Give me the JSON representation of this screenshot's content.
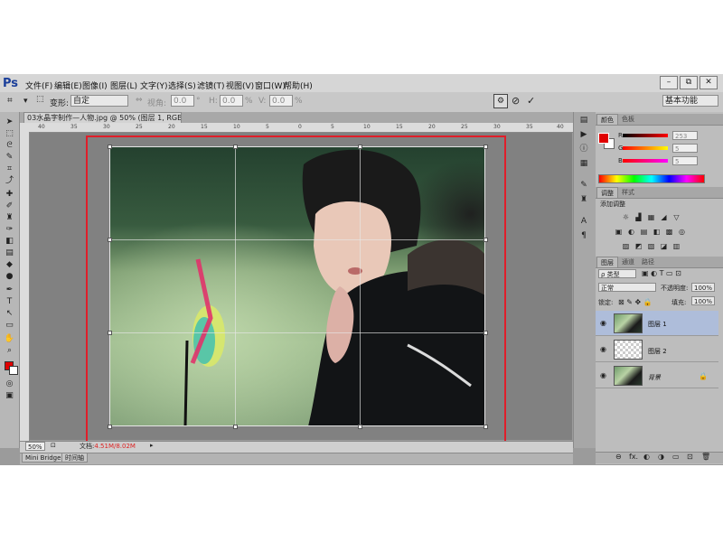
{
  "app": {
    "logo": "Ps"
  },
  "menu": [
    "文件(F)",
    "编辑(E)",
    "图像(I)",
    "图层(L)",
    "文字(Y)",
    "选择(S)",
    "滤镜(T)",
    "视图(V)",
    "窗口(W)",
    "帮助(H)"
  ],
  "window_controls": [
    "–",
    "⧉",
    "✕"
  ],
  "options": {
    "transform_label": "变形:",
    "preset_value": "自定",
    "h_label": "视角:",
    "h_value": "0.0",
    "hunit": "°",
    "v_label": "H:",
    "v_value": "0.0",
    "vunit": "%",
    "vh_label": "V:",
    "vh_value": "0.0",
    "workspace": "基本功能"
  },
  "document": {
    "tab_title": "03水晶字制作—人物.jpg @ 50% (图层 1, RGB/8#) *",
    "zoom": "50%",
    "doc_label": "文档:",
    "doc_size": "4.51M/8.02M"
  },
  "ruler_h_ticks": [
    "40",
    "35",
    "30",
    "25",
    "20",
    "15",
    "10",
    "5",
    "0",
    "5",
    "10",
    "15",
    "20",
    "25",
    "30",
    "35",
    "40"
  ],
  "bottom_tabs": [
    "Mini Bridge",
    "时间轴"
  ],
  "color_panel": {
    "tabs": [
      "颜色",
      "色板"
    ],
    "r_label": "R",
    "r_value": "253",
    "g_label": "G",
    "g_value": "5",
    "b_label": "B",
    "b_value": "5"
  },
  "adjust_panel": {
    "tabs": [
      "调整",
      "样式"
    ],
    "heading": "添加调整",
    "icons_row1": [
      "☼",
      "▟",
      "▦",
      "◢",
      "▽"
    ],
    "icons_row2": [
      "▣",
      "◐",
      "▤",
      "◧",
      "▩",
      "◎"
    ],
    "icons_row3": [
      "▨",
      "◩",
      "▧",
      "◪",
      "▥"
    ]
  },
  "layers_panel": {
    "tabs": [
      "图层",
      "通道",
      "路径"
    ],
    "filter_label": "ρ 类型",
    "blend_mode": "正常",
    "opacity_label": "不透明度:",
    "opacity_value": "100%",
    "lock_label": "锁定:",
    "fill_label": "填充:",
    "fill_value": "100%",
    "layers": [
      {
        "name": "图层 1"
      },
      {
        "name": "图层 2"
      },
      {
        "name": "背景"
      }
    ],
    "footer_icons": [
      "⊖",
      "fx.",
      "◐",
      "◑",
      "▭",
      "⊡",
      "🗑"
    ]
  }
}
